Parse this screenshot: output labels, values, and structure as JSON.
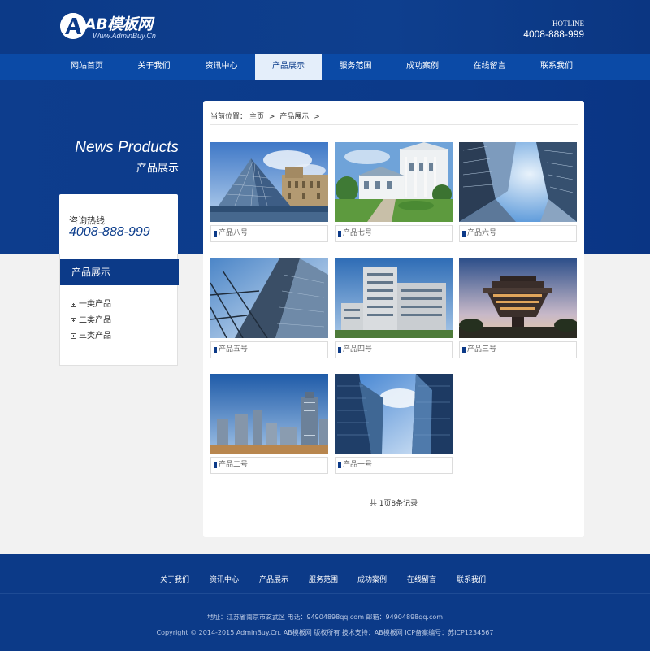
{
  "header": {
    "logo_main": "AB模板网",
    "logo_sub": "Www.AdminBuy.Cn",
    "hotline_label": "HOTLINE",
    "hotline_number": "4008-888-999"
  },
  "nav": {
    "items": [
      {
        "label": "网站首页"
      },
      {
        "label": "关于我们"
      },
      {
        "label": "资讯中心"
      },
      {
        "label": "产品展示"
      },
      {
        "label": "服务范围"
      },
      {
        "label": "成功案例"
      },
      {
        "label": "在线留言"
      },
      {
        "label": "联系我们"
      }
    ],
    "active_index": 3
  },
  "banner": {
    "title_en": "News Products",
    "title_cn": "产品展示"
  },
  "sidebar": {
    "hotline_label": "咨询热线",
    "hotline_number": "4008-888-999",
    "category_title": "产品展示",
    "categories": [
      {
        "label": "一类产品"
      },
      {
        "label": "二类产品"
      },
      {
        "label": "三类产品"
      }
    ]
  },
  "breadcrumb": {
    "prefix": "当前位置：",
    "home": "主页",
    "sep": ">",
    "current": "产品展示"
  },
  "products": [
    {
      "name": "产品八号",
      "image": "louvre-pyramid"
    },
    {
      "name": "产品七号",
      "image": "white-villa"
    },
    {
      "name": "产品六号",
      "image": "skyscrapers-upward"
    },
    {
      "name": "产品五号",
      "image": "steel-tower"
    },
    {
      "name": "产品四号",
      "image": "hospital-building"
    },
    {
      "name": "产品三号",
      "image": "brutalist-library"
    },
    {
      "name": "产品二号",
      "image": "city-skyline"
    },
    {
      "name": "产品一号",
      "image": "glass-towers"
    }
  ],
  "pager": {
    "text": "共 1页8条记录"
  },
  "footer": {
    "links": [
      {
        "label": "关于我们"
      },
      {
        "label": "资讯中心"
      },
      {
        "label": "产品展示"
      },
      {
        "label": "服务范围"
      },
      {
        "label": "成功案例"
      },
      {
        "label": "在线留言"
      },
      {
        "label": "联系我们"
      }
    ],
    "address": "地址：江苏省南京市玄武区   电话：94904898qq.com   邮箱：94904898qq.com",
    "copyright": "Copyright © 2014-2015 AdminBuy.Cn. AB模板网 版权所有   技术支持：AB模板网   ICP备案编号：苏ICP1234567"
  },
  "colors": {
    "primary": "#0c3a88",
    "nav": "#0b4aa6",
    "nav_active_bg": "#e4eefa"
  }
}
